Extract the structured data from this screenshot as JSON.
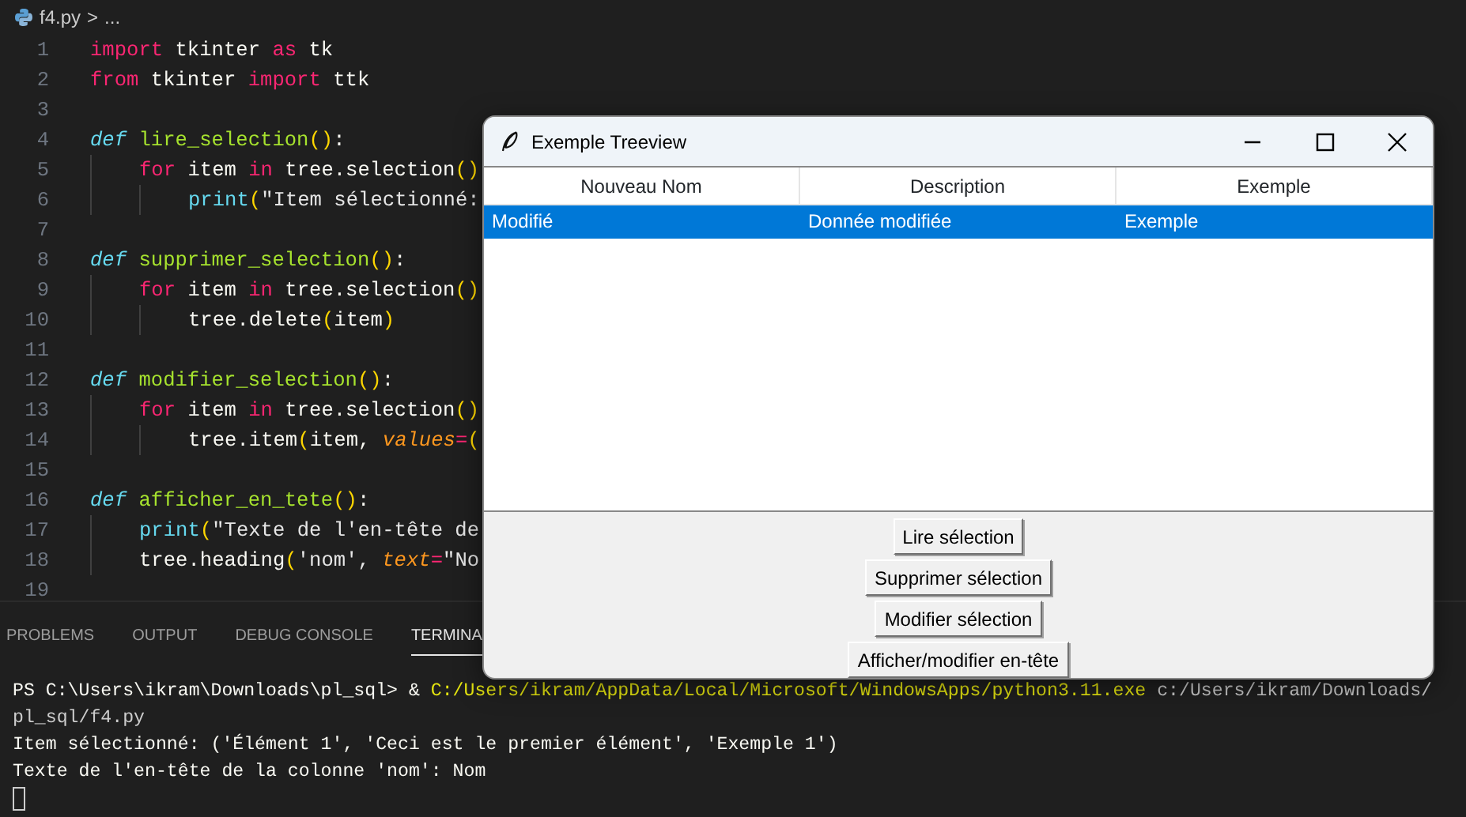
{
  "editor": {
    "breadcrumb": {
      "file": "f4.py",
      "separator": ">",
      "rest": "..."
    },
    "lines": [
      {
        "number": "1",
        "tokens": [
          {
            "text": "import",
            "kind": "keyword"
          },
          {
            "text": " tkinter ",
            "kind": "plain"
          },
          {
            "text": "as",
            "kind": "keyword"
          },
          {
            "text": " tk",
            "kind": "plain"
          }
        ]
      },
      {
        "number": "2",
        "tokens": [
          {
            "text": "from",
            "kind": "keyword"
          },
          {
            "text": " tkinter ",
            "kind": "plain"
          },
          {
            "text": "import",
            "kind": "keyword"
          },
          {
            "text": " ttk",
            "kind": "plain"
          }
        ]
      },
      {
        "number": "3"
      },
      {
        "number": "4",
        "tokens": [
          {
            "text": "def ",
            "kind": "def"
          },
          {
            "text": "lire_selection",
            "kind": "function"
          },
          {
            "text": "()",
            "kind": "bracket"
          },
          {
            "text": ":",
            "kind": "plain"
          }
        ],
        "children": [
          {
            "number": "5",
            "tokens": [
              {
                "text": "for",
                "kind": "keyword"
              },
              {
                "text": " item ",
                "kind": "plain"
              },
              {
                "text": "in",
                "kind": "keyword"
              },
              {
                "text": " tree.selection",
                "kind": "plain"
              },
              {
                "text": "()",
                "kind": "bracket"
              }
            ],
            "children": [
              {
                "number": "6",
                "tokens": [
                  {
                    "text": "print",
                    "kind": "builtin"
                  },
                  {
                    "text": "(",
                    "kind": "bracket"
                  },
                  {
                    "text": "\"Item sélectionné:",
                    "kind": "string"
                  }
                ]
              }
            ]
          }
        ]
      },
      {
        "number": "7"
      },
      {
        "number": "8",
        "tokens": [
          {
            "text": "def ",
            "kind": "def"
          },
          {
            "text": "supprimer_selection",
            "kind": "function"
          },
          {
            "text": "()",
            "kind": "bracket"
          },
          {
            "text": ":",
            "kind": "plain"
          }
        ],
        "children": [
          {
            "number": "9",
            "tokens": [
              {
                "text": "for",
                "kind": "keyword"
              },
              {
                "text": " item ",
                "kind": "plain"
              },
              {
                "text": "in",
                "kind": "keyword"
              },
              {
                "text": " tree.selection",
                "kind": "plain"
              },
              {
                "text": "()",
                "kind": "bracket"
              }
            ],
            "children": [
              {
                "number": "10",
                "tokens": [
                  {
                    "text": "tree.delete",
                    "kind": "plain"
                  },
                  {
                    "text": "(",
                    "kind": "bracket"
                  },
                  {
                    "text": "item",
                    "kind": "plain"
                  },
                  {
                    "text": ")",
                    "kind": "bracket"
                  }
                ]
              }
            ]
          }
        ]
      },
      {
        "number": "11"
      },
      {
        "number": "12",
        "tokens": [
          {
            "text": "def ",
            "kind": "def"
          },
          {
            "text": "modifier_selection",
            "kind": "function"
          },
          {
            "text": "()",
            "kind": "bracket"
          },
          {
            "text": ":",
            "kind": "plain"
          }
        ],
        "children": [
          {
            "number": "13",
            "tokens": [
              {
                "text": "for",
                "kind": "keyword"
              },
              {
                "text": " item ",
                "kind": "plain"
              },
              {
                "text": "in",
                "kind": "keyword"
              },
              {
                "text": " tree.selection",
                "kind": "plain"
              },
              {
                "text": "()",
                "kind": "bracket"
              }
            ],
            "children": [
              {
                "number": "14",
                "tokens": [
                  {
                    "text": "tree.item",
                    "kind": "plain"
                  },
                  {
                    "text": "(",
                    "kind": "bracket"
                  },
                  {
                    "text": "item, ",
                    "kind": "plain"
                  },
                  {
                    "text": "values",
                    "kind": "param"
                  },
                  {
                    "text": "=",
                    "kind": "keyword"
                  },
                  {
                    "text": "(",
                    "kind": "bracket"
                  }
                ]
              }
            ]
          }
        ]
      },
      {
        "number": "15"
      },
      {
        "number": "16",
        "tokens": [
          {
            "text": "def ",
            "kind": "def"
          },
          {
            "text": "afficher_en_tete",
            "kind": "function"
          },
          {
            "text": "()",
            "kind": "bracket"
          },
          {
            "text": ":",
            "kind": "plain"
          }
        ],
        "children": [
          {
            "number": "17",
            "tokens": [
              {
                "text": "print",
                "kind": "builtin"
              },
              {
                "text": "(",
                "kind": "bracket"
              },
              {
                "text": "\"Texte de l'en-tête de",
                "kind": "string"
              }
            ]
          },
          {
            "number": "18",
            "tokens": [
              {
                "text": "tree.heading",
                "kind": "plain"
              },
              {
                "text": "(",
                "kind": "bracket"
              },
              {
                "text": "'nom', ",
                "kind": "string"
              },
              {
                "text": "text",
                "kind": "param"
              },
              {
                "text": "=",
                "kind": "keyword"
              },
              {
                "text": "\"No",
                "kind": "string"
              }
            ]
          }
        ]
      },
      {
        "number": "19"
      }
    ]
  },
  "panel": {
    "tabs": [
      {
        "label": "PROBLEMS",
        "selected": false
      },
      {
        "label": "OUTPUT",
        "selected": false
      },
      {
        "label": "DEBUG CONSOLE",
        "selected": false
      },
      {
        "label": "TERMINA",
        "selected": true
      }
    ],
    "terminal_lines": [
      [
        {
          "text": "PS C:\\Users\\ikram\\Downloads\\pl_sql> & ",
          "kind": "plain"
        },
        {
          "text": "C:/Users/ikram/AppData/Local/Microsoft/WindowsApps/python3.11.exe",
          "kind": "command"
        },
        {
          "text": " c:/Users/ikram/Downloads/",
          "kind": "argument"
        }
      ],
      [
        {
          "text": "pl_sql/f4.py",
          "kind": "argument"
        }
      ],
      [
        {
          "text": "Item sélectionné: ('Élément 1', 'Ceci est le premier élément', 'Exemple 1')",
          "kind": "plain"
        }
      ],
      [
        {
          "text": "Texte de l'en-tête de la colonne 'nom': Nom",
          "kind": "plain"
        }
      ]
    ]
  },
  "window": {
    "title": "Exemple Treeview",
    "table": {
      "columns": [
        "Nouveau Nom",
        "Description",
        "Exemple"
      ],
      "rows": [
        {
          "cells": [
            "Modifié",
            "Donnée modifiée",
            "Exemple"
          ],
          "selected": true
        }
      ]
    },
    "buttons": [
      "Lire sélection",
      "Supprimer sélection",
      "Modifier sélection",
      "Afficher/modifier en-tête"
    ]
  }
}
